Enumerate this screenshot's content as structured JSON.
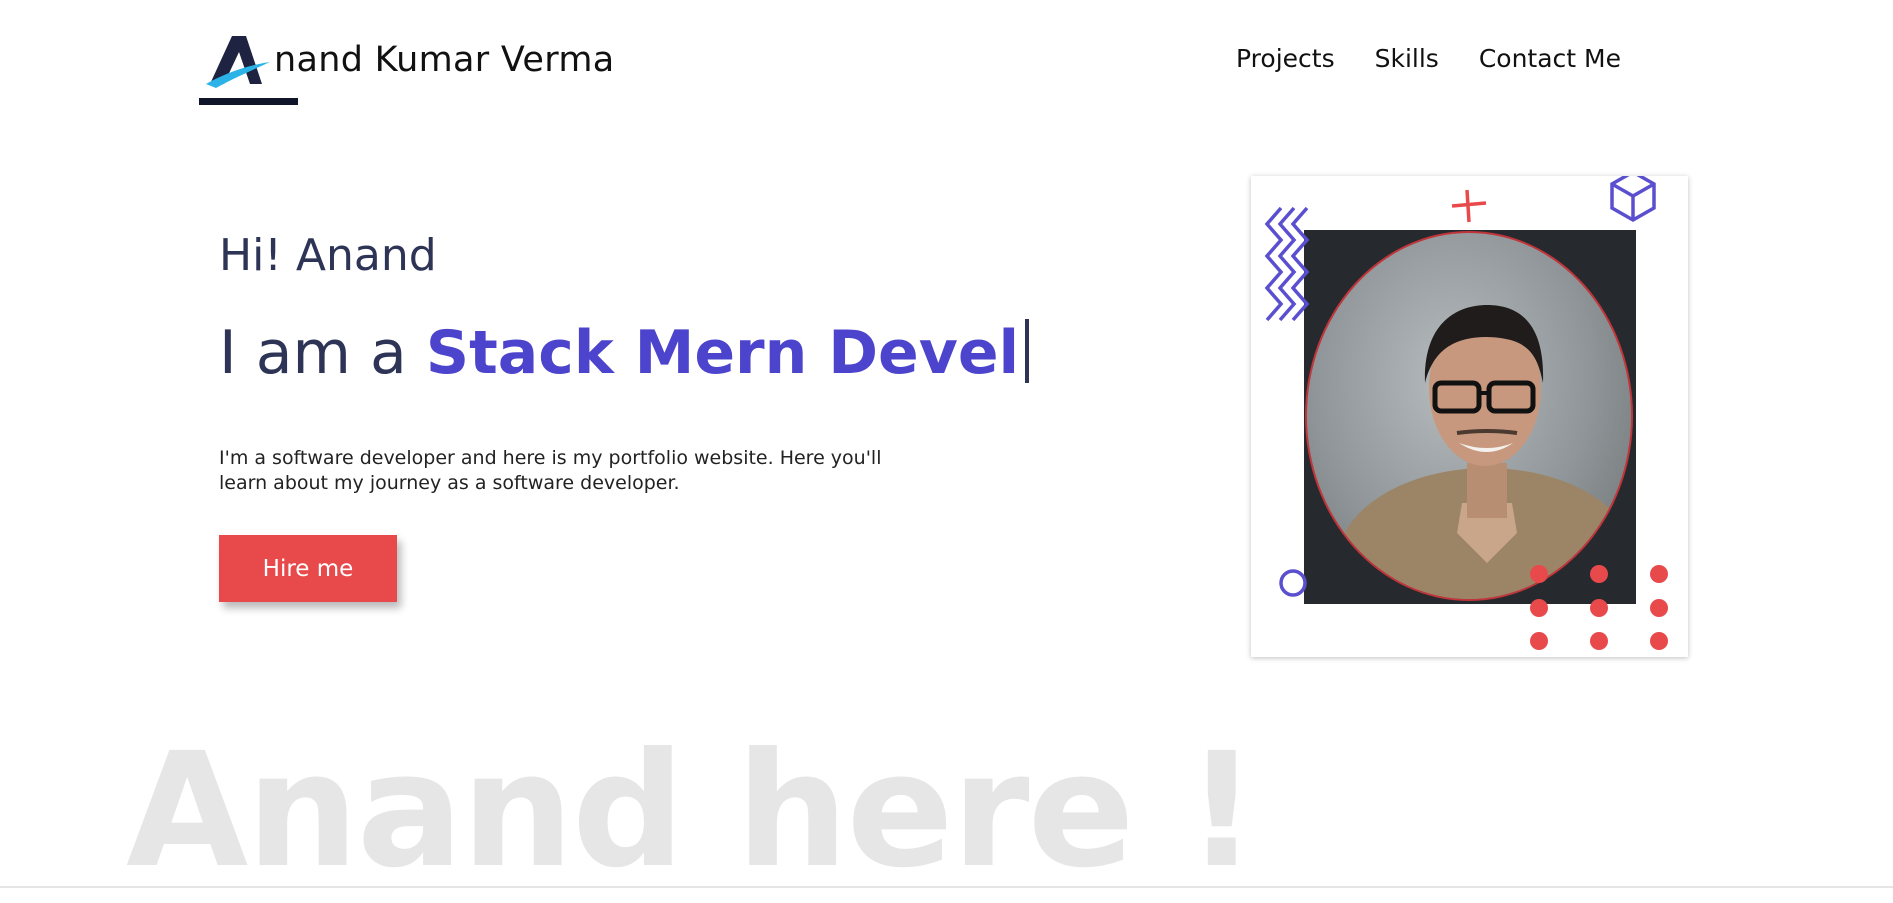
{
  "brand": {
    "logo_letter": "A",
    "name": "nand Kumar Verma"
  },
  "nav": {
    "items": [
      "Projects",
      "Skills",
      "Contact Me"
    ]
  },
  "hero": {
    "greeting": "Hi! Anand",
    "headline_prefix": "I am a ",
    "headline_role": "Stack Mern Devel",
    "intro": "I'm a software developer and here is my portfolio website. Here you'll learn about my journey as a software developer.",
    "hire_button": "Hire me"
  },
  "background_text": "Anand here !",
  "colors": {
    "accent_blue": "#4c44cc",
    "accent_red": "#e84a4c",
    "text_dark": "#2e3456"
  },
  "icons": [
    "logo-a-icon",
    "zigzag-icon",
    "plus-icon",
    "cube-icon",
    "ring-icon",
    "dot-grid-icon"
  ]
}
